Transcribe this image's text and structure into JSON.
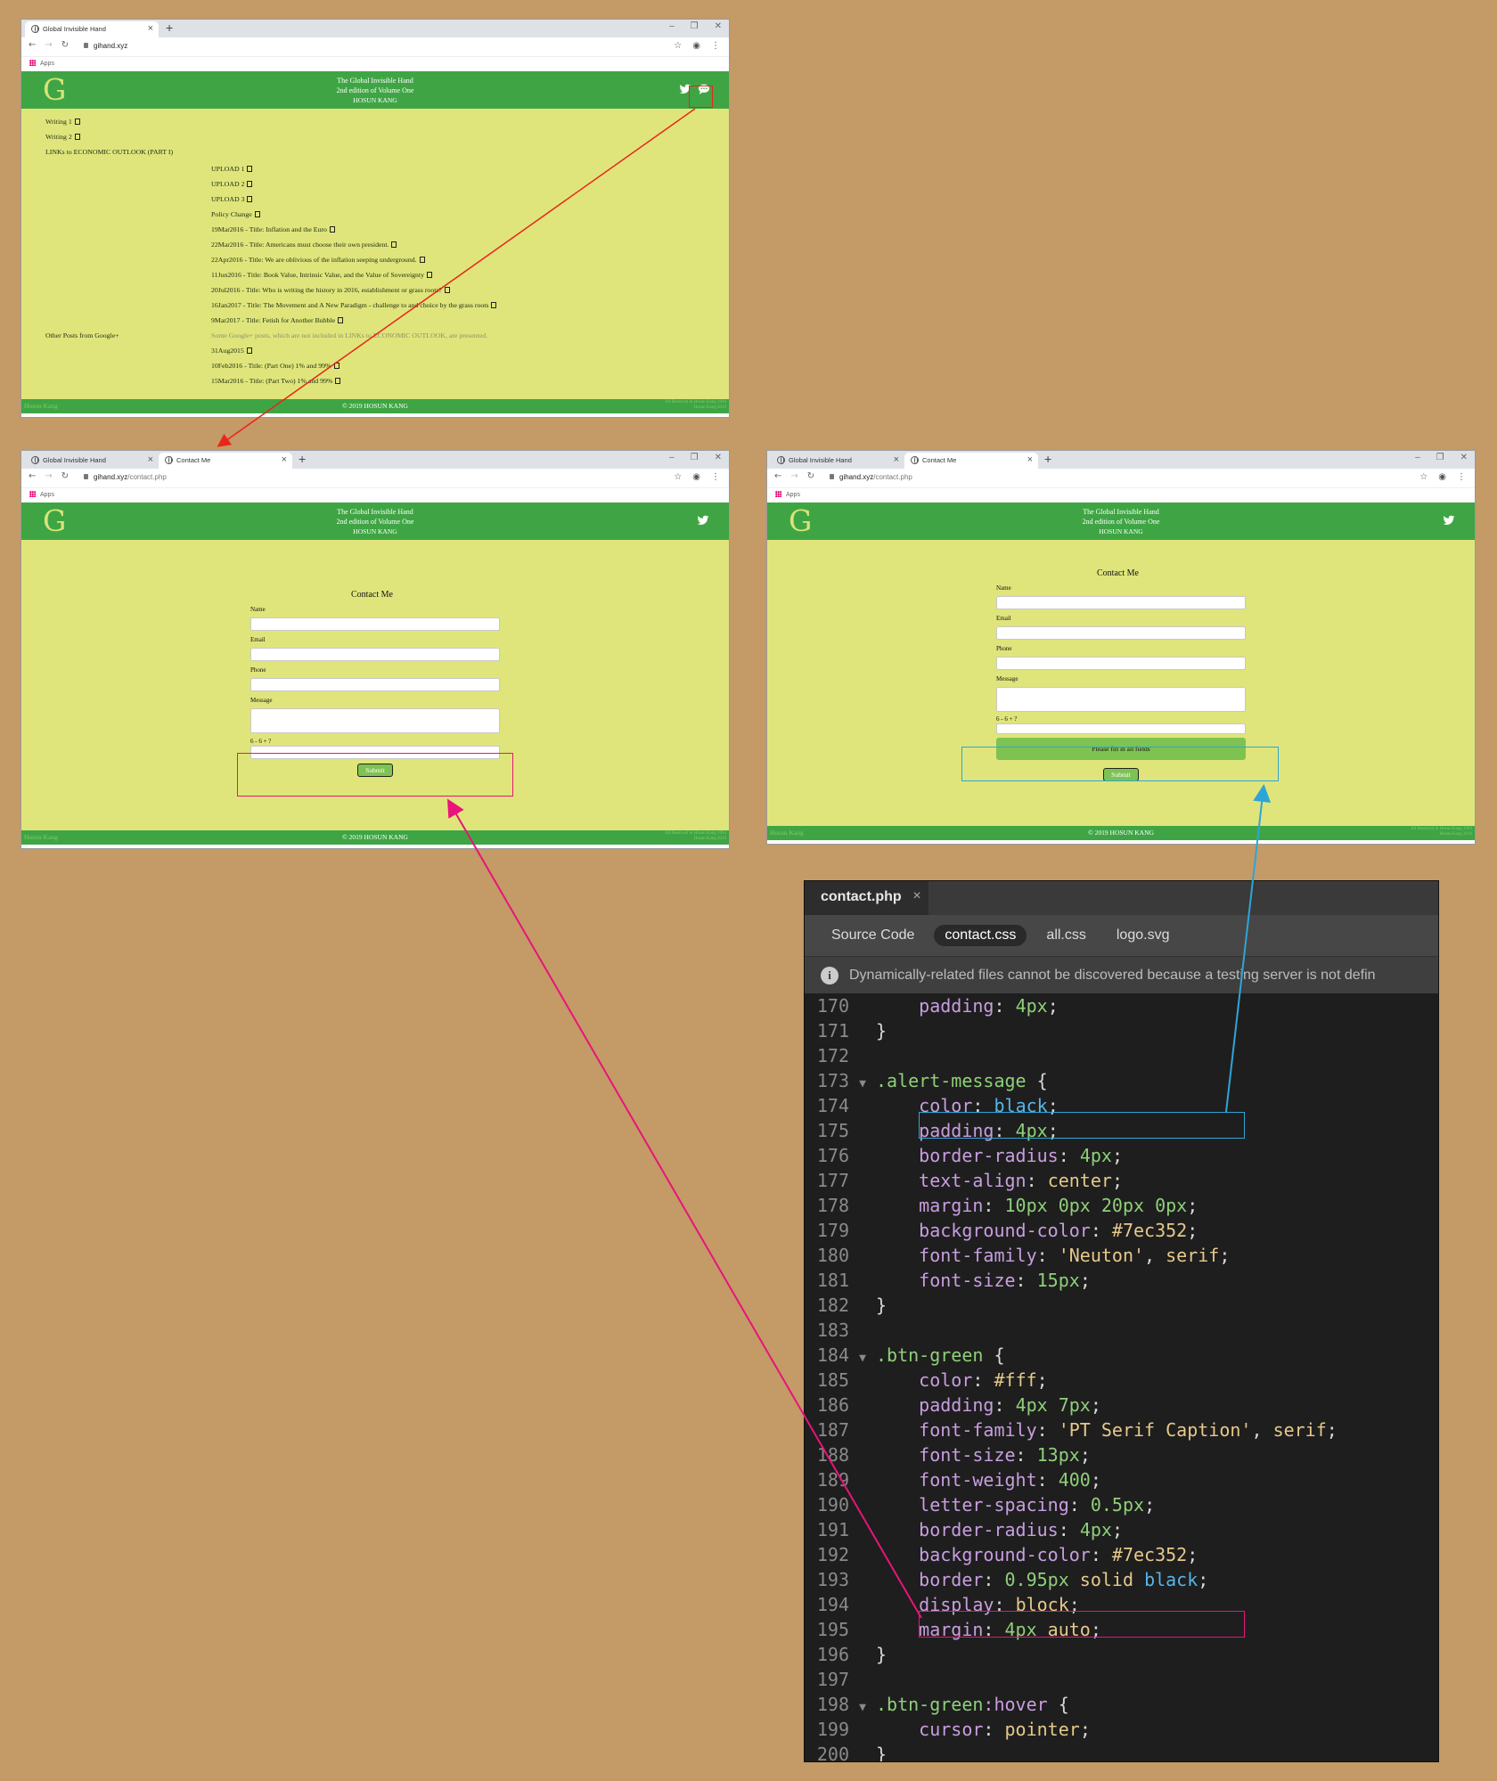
{
  "colors": {
    "background": "#c49a67",
    "site_green": "#3fa544",
    "site_body": "#dfe57b",
    "button_green": "#7ec352",
    "red_arrow": "#e8261a",
    "magenta_arrow": "#e8147a",
    "blue_arrow": "#2ea5d8"
  },
  "browser1": {
    "tab1": "Global Invisible Hand",
    "url": "gihand.xyz",
    "bookmarks": "Apps"
  },
  "browser2": {
    "tab1": "Global Invisible Hand",
    "tab2": "Contact Me",
    "url_host": "gihand.xyz",
    "url_path": "/contact.php",
    "bookmarks": "Apps"
  },
  "site": {
    "logo": "G",
    "title1": "The Global Invisible Hand",
    "title2": "2nd edition of Volume One",
    "author": "HOSUN KANG",
    "footer_left": "Hosun Kang",
    "footer_center": "© 2019 HOSUN KANG",
    "footer_right1": "All Reserved in Hosun Kang 1994",
    "footer_right2": "Hosun Kang 2019",
    "twitter_icon": "twitter-icon",
    "chat_icon": "chat-bubble-icon"
  },
  "home": {
    "links": [
      "Writing 1",
      "Writing 2",
      "LINKs to ECONOMIC OUTLOOK (PART I)",
      "UPLOAD 1",
      "UPLOAD 2",
      "UPLOAD 3",
      "Policy Change",
      "19Mar2016 - Title: Inflation and the Euro",
      "22Mar2016 - Title: Americans must choose their own president.",
      "22Apr2016 - Title: We are oblivious of the inflation seeping underground.",
      "11Jun2016 - Title: Book Value, Intrinsic Value, and the Value of Sovereignty",
      "20Jul2016 - Title: Who is writing the history in 2016, establishment or grass roots?",
      "16Jan2017 - Title: The Movement and A New Paradigm - challenge to and choice by the grass roots",
      "9Mar2017 - Title: Fetish for Another Bubble",
      "Other Posts from Google+",
      "Some Google+ posts, which are not included in LINKs to ECONOMIC OUTLOOK, are presented.",
      "31Aug2015",
      "10Feb2016 - Title: (Part One) 1% and 99%",
      "15Mar2016 - Title: (Part Two) 1% and 99%"
    ]
  },
  "contact": {
    "title": "Contact Me",
    "name_label": "Name",
    "email_label": "Email",
    "phone_label": "Phone",
    "message_label": "Message",
    "captcha_label": "6 - 6 + ?",
    "submit": "Submit",
    "alert": "Please fill in all fields"
  },
  "editor": {
    "file_tab": "contact.php",
    "close": "×",
    "subtabs": [
      "Source Code",
      "contact.css",
      "all.css",
      "logo.svg"
    ],
    "info": "Dynamically-related files cannot be discovered because a testing server is not defin",
    "lines": [
      {
        "n": "170",
        "f": "",
        "t": [
          [
            "    ",
            ""
          ],
          [
            "padding",
            "c-prop"
          ],
          [
            ": ",
            "c-pun"
          ],
          [
            "4px",
            "c-num"
          ],
          [
            ";",
            "c-pun"
          ]
        ]
      },
      {
        "n": "171",
        "f": "",
        "t": [
          [
            "}",
            "c-pun"
          ]
        ]
      },
      {
        "n": "172",
        "f": "",
        "t": []
      },
      {
        "n": "173",
        "f": "▼",
        "t": [
          [
            ".alert-message",
            "c-sel"
          ],
          [
            " {",
            "c-pun"
          ]
        ]
      },
      {
        "n": "174",
        "f": "",
        "t": [
          [
            "    ",
            ""
          ],
          [
            "color",
            "c-prop"
          ],
          [
            ": ",
            "c-pun"
          ],
          [
            "black",
            "c-kw"
          ],
          [
            ";",
            "c-pun"
          ]
        ]
      },
      {
        "n": "175",
        "f": "",
        "t": [
          [
            "    ",
            ""
          ],
          [
            "padding",
            "c-prop"
          ],
          [
            ": ",
            "c-pun"
          ],
          [
            "4px",
            "c-num"
          ],
          [
            ";",
            "c-pun"
          ]
        ]
      },
      {
        "n": "176",
        "f": "",
        "t": [
          [
            "    ",
            ""
          ],
          [
            "border-radius",
            "c-prop"
          ],
          [
            ": ",
            "c-pun"
          ],
          [
            "4px",
            "c-num"
          ],
          [
            ";",
            "c-pun"
          ]
        ]
      },
      {
        "n": "177",
        "f": "",
        "t": [
          [
            "    ",
            ""
          ],
          [
            "text-align",
            "c-prop"
          ],
          [
            ": ",
            "c-pun"
          ],
          [
            "center",
            "c-val"
          ],
          [
            ";",
            "c-pun"
          ]
        ]
      },
      {
        "n": "178",
        "f": "",
        "t": [
          [
            "    ",
            ""
          ],
          [
            "margin",
            "c-prop"
          ],
          [
            ": ",
            "c-pun"
          ],
          [
            "10px 0px 20px 0px",
            "c-num"
          ],
          [
            ";",
            "c-pun"
          ]
        ]
      },
      {
        "n": "179",
        "f": "",
        "t": [
          [
            "    ",
            ""
          ],
          [
            "background-color",
            "c-prop"
          ],
          [
            ": ",
            "c-pun"
          ],
          [
            "#7ec352",
            "c-val"
          ],
          [
            ";",
            "c-pun"
          ]
        ]
      },
      {
        "n": "180",
        "f": "",
        "t": [
          [
            "    ",
            ""
          ],
          [
            "font-family",
            "c-prop"
          ],
          [
            ": ",
            "c-pun"
          ],
          [
            "'Neuton'",
            "c-str"
          ],
          [
            ", ",
            "c-pun"
          ],
          [
            "serif",
            "c-val"
          ],
          [
            ";",
            "c-pun"
          ]
        ]
      },
      {
        "n": "181",
        "f": "",
        "t": [
          [
            "    ",
            ""
          ],
          [
            "font-size",
            "c-prop"
          ],
          [
            ": ",
            "c-pun"
          ],
          [
            "15px",
            "c-num"
          ],
          [
            ";",
            "c-pun"
          ]
        ]
      },
      {
        "n": "182",
        "f": "",
        "t": [
          [
            "}",
            "c-pun"
          ]
        ]
      },
      {
        "n": "183",
        "f": "",
        "t": []
      },
      {
        "n": "184",
        "f": "▼",
        "t": [
          [
            ".btn-green",
            "c-sel"
          ],
          [
            " {",
            "c-pun"
          ]
        ]
      },
      {
        "n": "185",
        "f": "",
        "t": [
          [
            "    ",
            ""
          ],
          [
            "color",
            "c-prop"
          ],
          [
            ": ",
            "c-pun"
          ],
          [
            "#fff",
            "c-val"
          ],
          [
            ";",
            "c-pun"
          ]
        ]
      },
      {
        "n": "186",
        "f": "",
        "t": [
          [
            "    ",
            ""
          ],
          [
            "padding",
            "c-prop"
          ],
          [
            ": ",
            "c-pun"
          ],
          [
            "4px 7px",
            "c-num"
          ],
          [
            ";",
            "c-pun"
          ]
        ]
      },
      {
        "n": "187",
        "f": "",
        "t": [
          [
            "    ",
            ""
          ],
          [
            "font-family",
            "c-prop"
          ],
          [
            ": ",
            "c-pun"
          ],
          [
            "'PT Serif Caption'",
            "c-str"
          ],
          [
            ", ",
            "c-pun"
          ],
          [
            "serif",
            "c-val"
          ],
          [
            ";",
            "c-pun"
          ]
        ]
      },
      {
        "n": "188",
        "f": "",
        "t": [
          [
            "    ",
            ""
          ],
          [
            "font-size",
            "c-prop"
          ],
          [
            ": ",
            "c-pun"
          ],
          [
            "13px",
            "c-num"
          ],
          [
            ";",
            "c-pun"
          ]
        ]
      },
      {
        "n": "189",
        "f": "",
        "t": [
          [
            "    ",
            ""
          ],
          [
            "font-weight",
            "c-prop"
          ],
          [
            ": ",
            "c-pun"
          ],
          [
            "400",
            "c-num"
          ],
          [
            ";",
            "c-pun"
          ]
        ]
      },
      {
        "n": "190",
        "f": "",
        "t": [
          [
            "    ",
            ""
          ],
          [
            "letter-spacing",
            "c-prop"
          ],
          [
            ": ",
            "c-pun"
          ],
          [
            "0.5px",
            "c-num"
          ],
          [
            ";",
            "c-pun"
          ]
        ]
      },
      {
        "n": "191",
        "f": "",
        "t": [
          [
            "    ",
            ""
          ],
          [
            "border-radius",
            "c-prop"
          ],
          [
            ": ",
            "c-pun"
          ],
          [
            "4px",
            "c-num"
          ],
          [
            ";",
            "c-pun"
          ]
        ]
      },
      {
        "n": "192",
        "f": "",
        "t": [
          [
            "    ",
            ""
          ],
          [
            "background-color",
            "c-prop"
          ],
          [
            ": ",
            "c-pun"
          ],
          [
            "#7ec352",
            "c-val"
          ],
          [
            ";",
            "c-pun"
          ]
        ]
      },
      {
        "n": "193",
        "f": "",
        "t": [
          [
            "    ",
            ""
          ],
          [
            "border",
            "c-prop"
          ],
          [
            ": ",
            "c-pun"
          ],
          [
            "0.95px",
            "c-num"
          ],
          [
            " solid ",
            "c-val"
          ],
          [
            "black",
            "c-kw"
          ],
          [
            ";",
            "c-pun"
          ]
        ]
      },
      {
        "n": "194",
        "f": "",
        "t": [
          [
            "    ",
            ""
          ],
          [
            "display",
            "c-prop"
          ],
          [
            ": ",
            "c-pun"
          ],
          [
            "block",
            "c-val"
          ],
          [
            ";",
            "c-pun"
          ]
        ]
      },
      {
        "n": "195",
        "f": "",
        "t": [
          [
            "    ",
            ""
          ],
          [
            "margin",
            "c-prop"
          ],
          [
            ": ",
            "c-pun"
          ],
          [
            "4px",
            "c-num"
          ],
          [
            " auto",
            "c-val"
          ],
          [
            ";",
            "c-pun"
          ]
        ]
      },
      {
        "n": "196",
        "f": "",
        "t": [
          [
            "}",
            "c-pun"
          ]
        ]
      },
      {
        "n": "197",
        "f": "",
        "t": []
      },
      {
        "n": "198",
        "f": "▼",
        "t": [
          [
            ".btn-green",
            "c-sel"
          ],
          [
            ":hover",
            "c-prop"
          ],
          [
            " {",
            "c-pun"
          ]
        ]
      },
      {
        "n": "199",
        "f": "",
        "t": [
          [
            "    ",
            ""
          ],
          [
            "cursor",
            "c-prop"
          ],
          [
            ": ",
            "c-pun"
          ],
          [
            "pointer",
            "c-val"
          ],
          [
            ";",
            "c-pun"
          ]
        ]
      },
      {
        "n": "200",
        "f": "",
        "t": [
          [
            "}",
            "c-pun"
          ]
        ]
      }
    ]
  }
}
